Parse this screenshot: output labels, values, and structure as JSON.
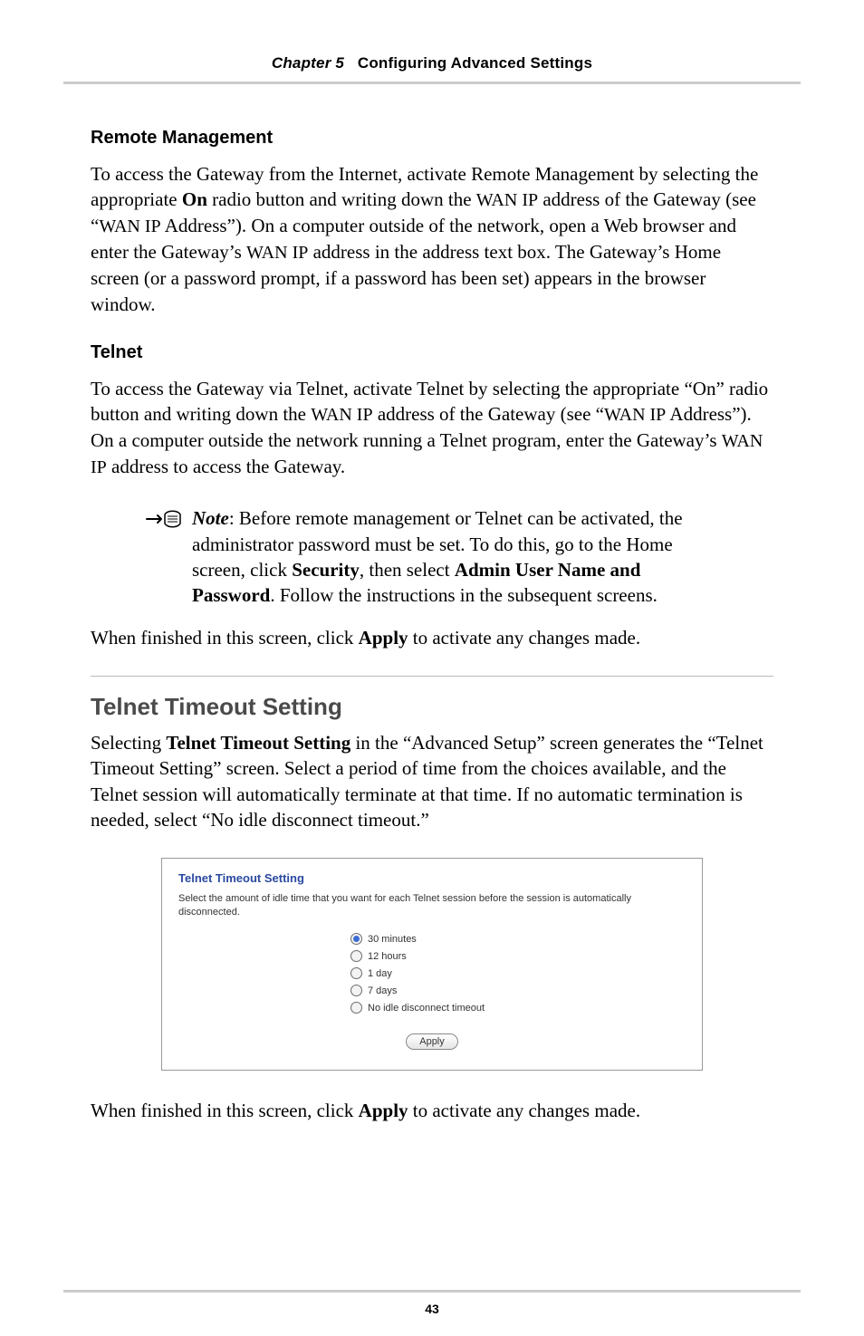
{
  "header": {
    "chapter_label": "Chapter 5",
    "chapter_title": "Configuring Advanced Settings"
  },
  "section_remote": {
    "heading": "Remote Management",
    "body_parts": [
      "To access the Gateway from the Internet, activate Remote Management by selecting the appropriate ",
      "On",
      " radio button and writing down the ",
      "WAN IP",
      " address of the Gateway (see “",
      "WAN IP",
      " Address”). On a computer outside of the network, open a Web browser and enter the Gateway’s ",
      "WAN IP",
      " address in the address text box. The Gateway’s Home screen (or a password prompt, if a password has been set) appears in the browser window."
    ]
  },
  "section_telnet": {
    "heading": "Telnet",
    "body_parts": [
      "To access the Gateway via Telnet, activate Telnet by selecting the appropriate “On” radio button and writing down the ",
      "WAN IP",
      " address of the Gateway (see “",
      "WAN IP",
      " Address”). On a computer outside the network running a Telnet program, enter the Gateway’s ",
      "WAN IP",
      " address to access the Gateway."
    ],
    "note_parts": [
      "Note",
      ": Before remote management or Telnet can be activated, the administrator password must be set. To do this, go to the Home screen, click ",
      "Security",
      ", then select ",
      "Admin User Name and Password",
      ". Follow the instructions in the subsequent screens."
    ],
    "closing_parts": [
      "When finished in this screen, click ",
      "Apply",
      " to activate any changes made."
    ]
  },
  "section_timeout": {
    "heading": "Telnet Timeout Setting",
    "body_parts": [
      "Selecting ",
      "Telnet Timeout Setting",
      " in the “Advanced Setup” screen generates the “Telnet Timeout Setting” screen. Select a period of time from the choices available, and the Telnet session will automatically terminate at that time. If no automatic termination is needed, select “No idle disconnect timeout.”"
    ],
    "panel": {
      "title": "Telnet Timeout Setting",
      "description": "Select the amount of idle time that you want for each Telnet session before the session is automatically disconnected.",
      "options": [
        {
          "label": "30 minutes",
          "selected": true
        },
        {
          "label": "12 hours",
          "selected": false
        },
        {
          "label": "1 day",
          "selected": false
        },
        {
          "label": "7 days",
          "selected": false
        },
        {
          "label": "No idle disconnect timeout",
          "selected": false
        }
      ],
      "apply_label": "Apply"
    },
    "closing_parts": [
      "When finished in this screen, click ",
      "Apply",
      " to activate any changes made."
    ]
  },
  "page_number": "43"
}
